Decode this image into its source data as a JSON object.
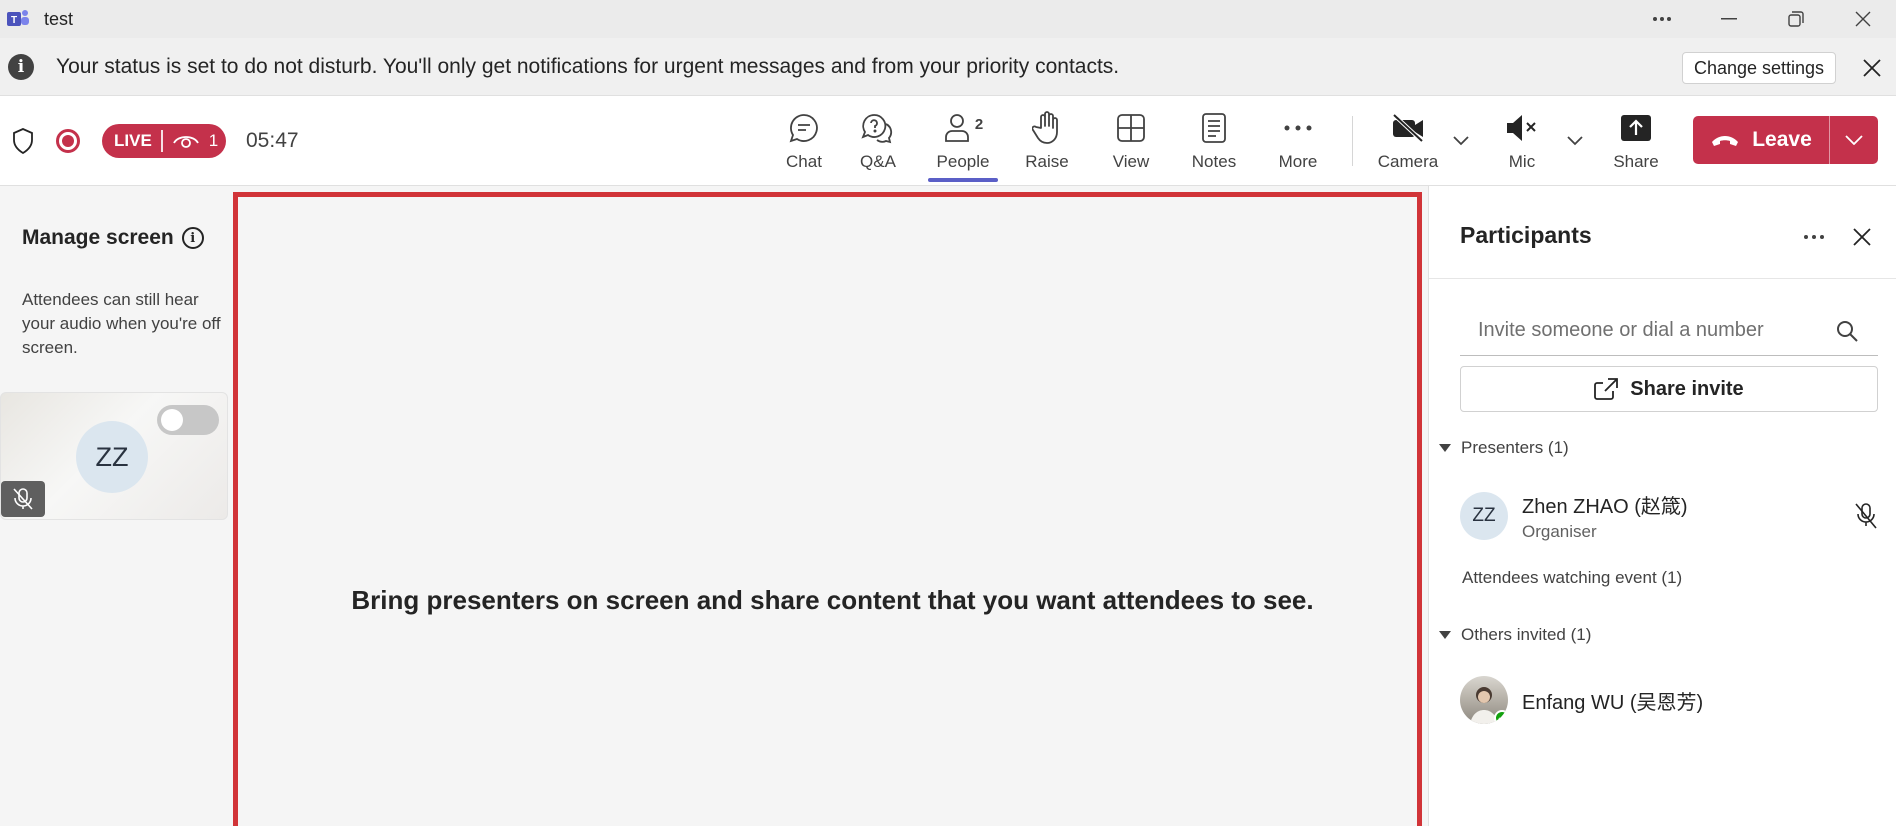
{
  "window": {
    "title": "test"
  },
  "notice": {
    "text": "Your status is set to do not disturb. You'll only get notifications for urgent messages and from your priority contacts.",
    "action_label": "Change settings"
  },
  "toolbar": {
    "live_label": "LIVE",
    "viewer_count": "1",
    "timer": "05:47",
    "buttons": {
      "chat": "Chat",
      "qa": "Q&A",
      "people": "People",
      "people_count": "2",
      "raise": "Raise",
      "view": "View",
      "notes": "Notes",
      "more": "More",
      "camera": "Camera",
      "mic": "Mic",
      "share": "Share"
    },
    "leave_label": "Leave"
  },
  "left_panel": {
    "title": "Manage screen",
    "description": "Attendees can still hear your audio when you're off screen.",
    "card_initials": "ZZ"
  },
  "stage": {
    "message": "Bring presenters on screen and share content that you want attendees to see."
  },
  "participants": {
    "title": "Participants",
    "invite_placeholder": "Invite someone or dial a number",
    "share_invite_label": "Share invite",
    "presenters_heading": "Presenters (1)",
    "presenters": [
      {
        "initials": "ZZ",
        "name": "Zhen ZHAO (赵箴)",
        "role": "Organiser"
      }
    ],
    "attendees_heading": "Attendees watching event (1)",
    "others_heading": "Others invited (1)",
    "others": [
      {
        "name": "Enfang WU (吴恩芳)"
      }
    ]
  },
  "colors": {
    "accent": "#5b5fc7",
    "live_red": "#c4314b",
    "stage_border": "#d13438",
    "presence_green": "#13a10e"
  }
}
